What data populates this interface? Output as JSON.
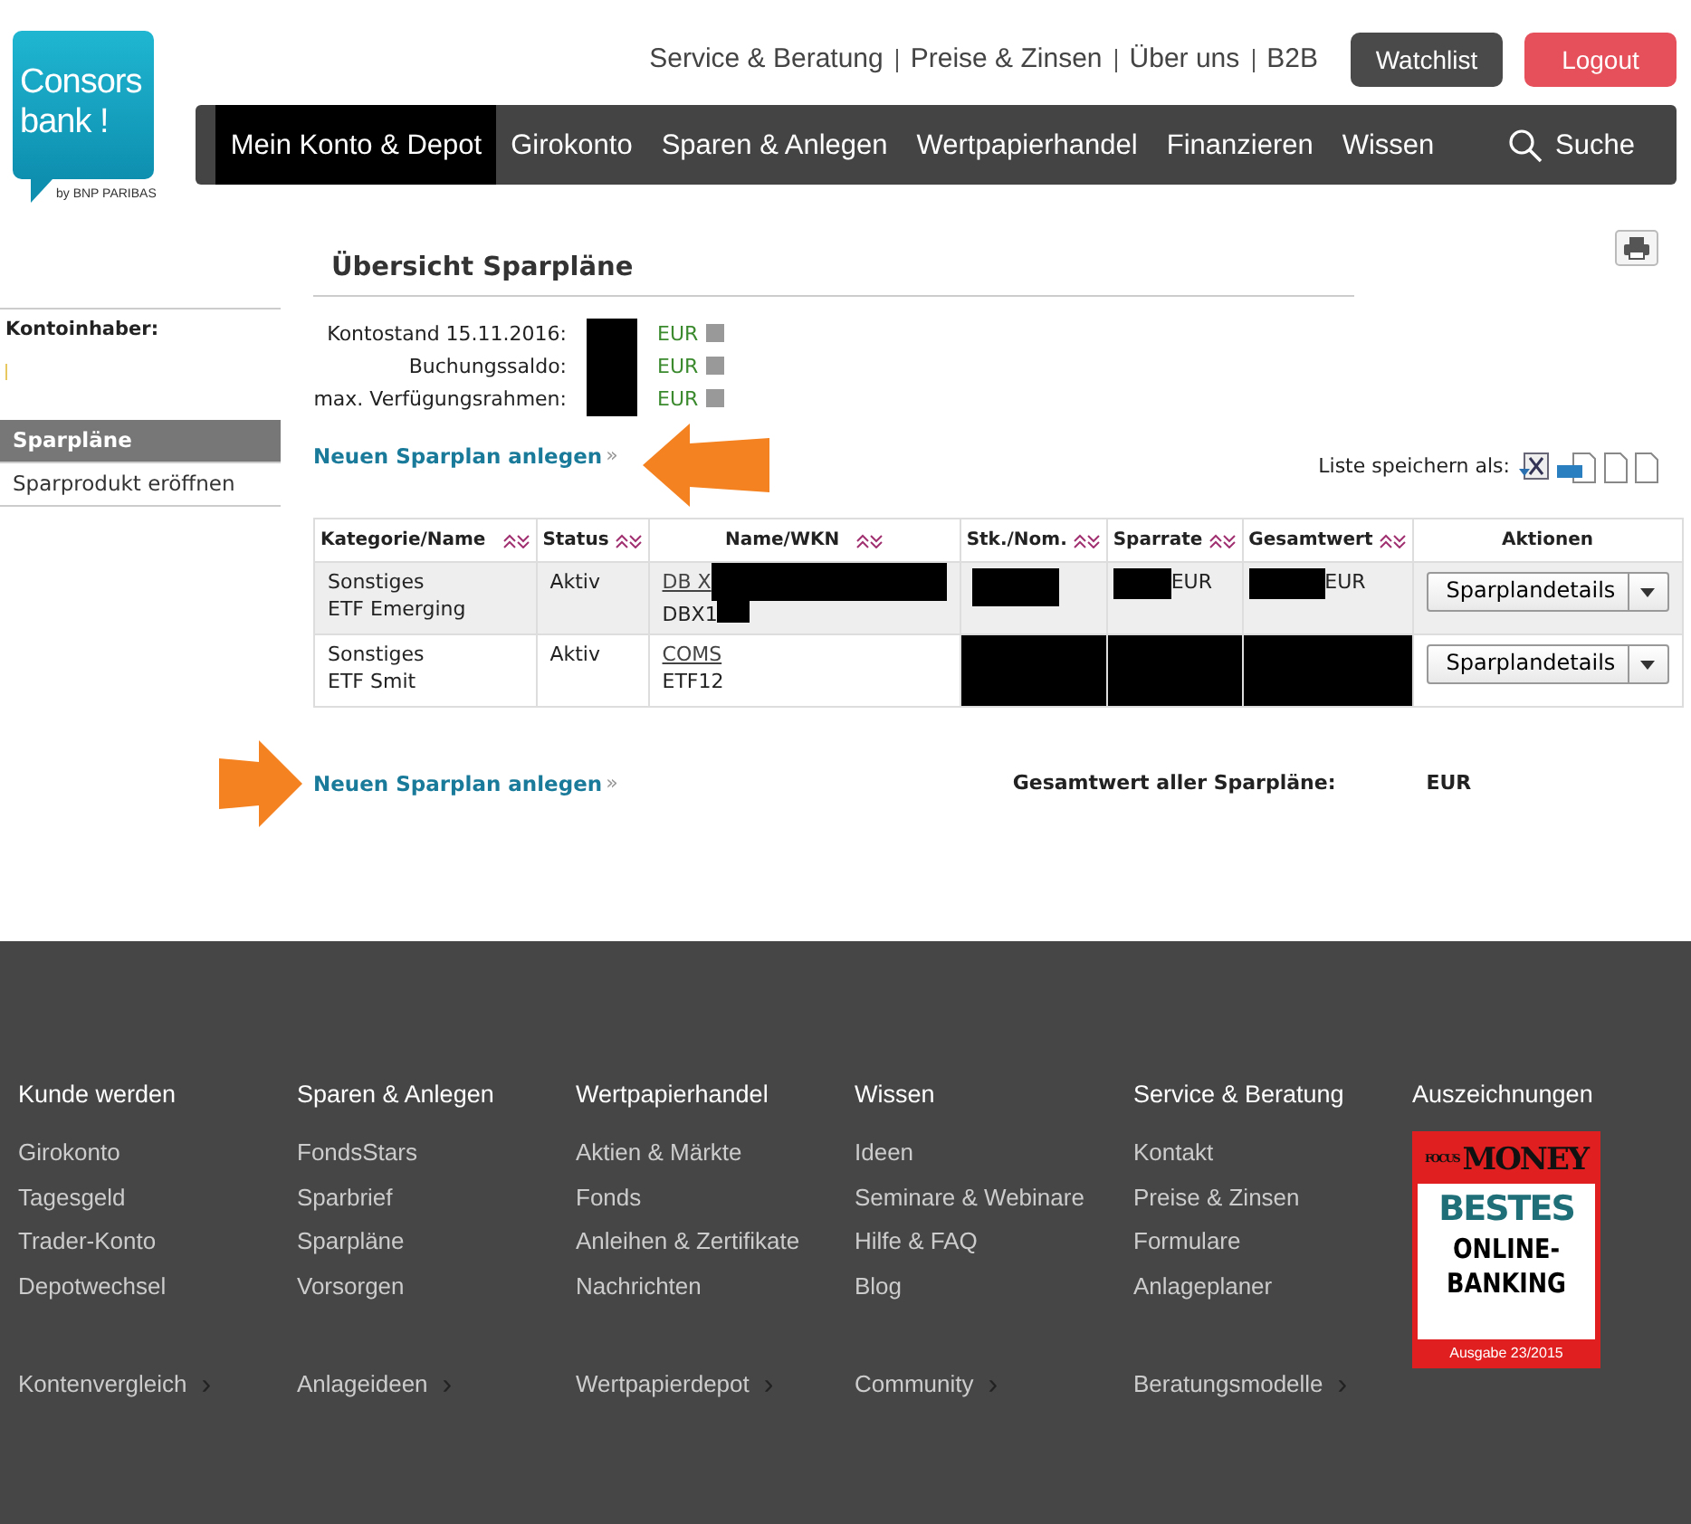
{
  "logo": {
    "lines": [
      "Consors",
      "bank !"
    ],
    "tagline": "by BNP PARIBAS"
  },
  "top_links": [
    "Service & Beratung",
    "Preise & Zinsen",
    "Über uns",
    "B2B"
  ],
  "top_buttons": [
    {
      "label": "Watchlist",
      "kind": "dark"
    },
    {
      "label": "Logout",
      "kind": "danger"
    }
  ],
  "nav": [
    {
      "label": "Mein Konto & Depot",
      "selected": true
    },
    {
      "label": "Girokonto",
      "selected": false
    },
    {
      "label": "Sparen & Anlegen",
      "selected": false
    },
    {
      "label": "Wertpapierhandel",
      "selected": false
    },
    {
      "label": "Finanzieren",
      "selected": false
    },
    {
      "label": "Wissen",
      "selected": false
    }
  ],
  "search_label": "Suche",
  "sidebar": {
    "holder_label": "Kontoinhaber:",
    "items": [
      {
        "label": "Sparpläne",
        "selected": true
      },
      {
        "label": "Sparprodukt eröffnen",
        "selected": false
      }
    ]
  },
  "page_title": "Übersicht Sparpläne",
  "balances": [
    {
      "label": "Kontostand 15.11.2016:",
      "currency": "EUR"
    },
    {
      "label": "Buchungssaldo:",
      "currency": "EUR"
    },
    {
      "label": "max. Verfügungsrahmen:",
      "currency": "EUR"
    }
  ],
  "new_plan_links": [
    {
      "label": "Neuen Sparplan anlegen",
      "chevron": "»"
    },
    {
      "label": "Neuen Sparplan anlegen",
      "chevron": "»"
    }
  ],
  "export_label": "Liste speichern als:",
  "table": {
    "columns": [
      {
        "label": "Kategorie/Name",
        "sortable": true
      },
      {
        "label": "Status",
        "sortable": true
      },
      {
        "label": "Name/WKN",
        "sortable": true
      },
      {
        "label": "Stk./Nom.",
        "sortable": true
      },
      {
        "label": "Sparrate",
        "sortable": true
      },
      {
        "label": "Gesamtwert",
        "sortable": true
      },
      {
        "label": "Aktionen",
        "sortable": false
      }
    ],
    "rows": [
      {
        "shaded": true,
        "category": "Sonstiges",
        "name": "ETF Emerging",
        "status": "Aktiv",
        "product": "DB X",
        "wkn": "DBX1",
        "name_redacted": true,
        "values_blacked_out": false,
        "rate": "EUR",
        "total": "EUR",
        "action": "Sparplandetails"
      },
      {
        "shaded": false,
        "category": "Sonstiges",
        "name": "ETF Smit",
        "status": "Aktiv",
        "product": "COMS",
        "wkn": "ETF12",
        "name_redacted": false,
        "values_blacked_out": true,
        "action": "Sparplandetails"
      }
    ]
  },
  "grand_total": {
    "label": "Gesamtwert aller Sparpläne:",
    "currency": "EUR"
  },
  "footer": {
    "columns": [
      {
        "title": "Kunde werden",
        "links": [
          "Girokonto",
          "Tagesgeld",
          "Trader-Konto",
          "Depotwechsel"
        ],
        "more": "Kontenvergleich",
        "more_chevron": "›"
      },
      {
        "title": "Sparen & Anlegen",
        "links": [
          "FondsStars",
          "Sparbrief",
          "Sparpläne",
          "Vorsorgen"
        ],
        "more": "Anlageideen",
        "more_chevron": "›"
      },
      {
        "title": "Wertpapierhandel",
        "links": [
          "Aktien & Märkte",
          "Fonds",
          "Anleihen & Zertifikate",
          "Nachrichten"
        ],
        "more": "Wertpapierdepot",
        "more_chevron": "›"
      },
      {
        "title": "Wissen",
        "links": [
          "Ideen",
          "Seminare & Webinare",
          "Hilfe & FAQ",
          "Blog"
        ],
        "more": "Community",
        "more_chevron": "›"
      },
      {
        "title": "Service & Beratung",
        "links": [
          "Kontakt",
          "Preise & Zinsen",
          "Formulare",
          "Anlageplaner"
        ],
        "more": "Beratungsmodelle",
        "more_chevron": "›"
      }
    ],
    "awards": {
      "title": "Auszeichnungen",
      "badge": {
        "brand_small": "FOCUS",
        "brand": "MONEY",
        "headline": "BESTES",
        "subline": "ONLINE-BANKING",
        "issue": "Ausgabe 23/2015"
      }
    }
  }
}
